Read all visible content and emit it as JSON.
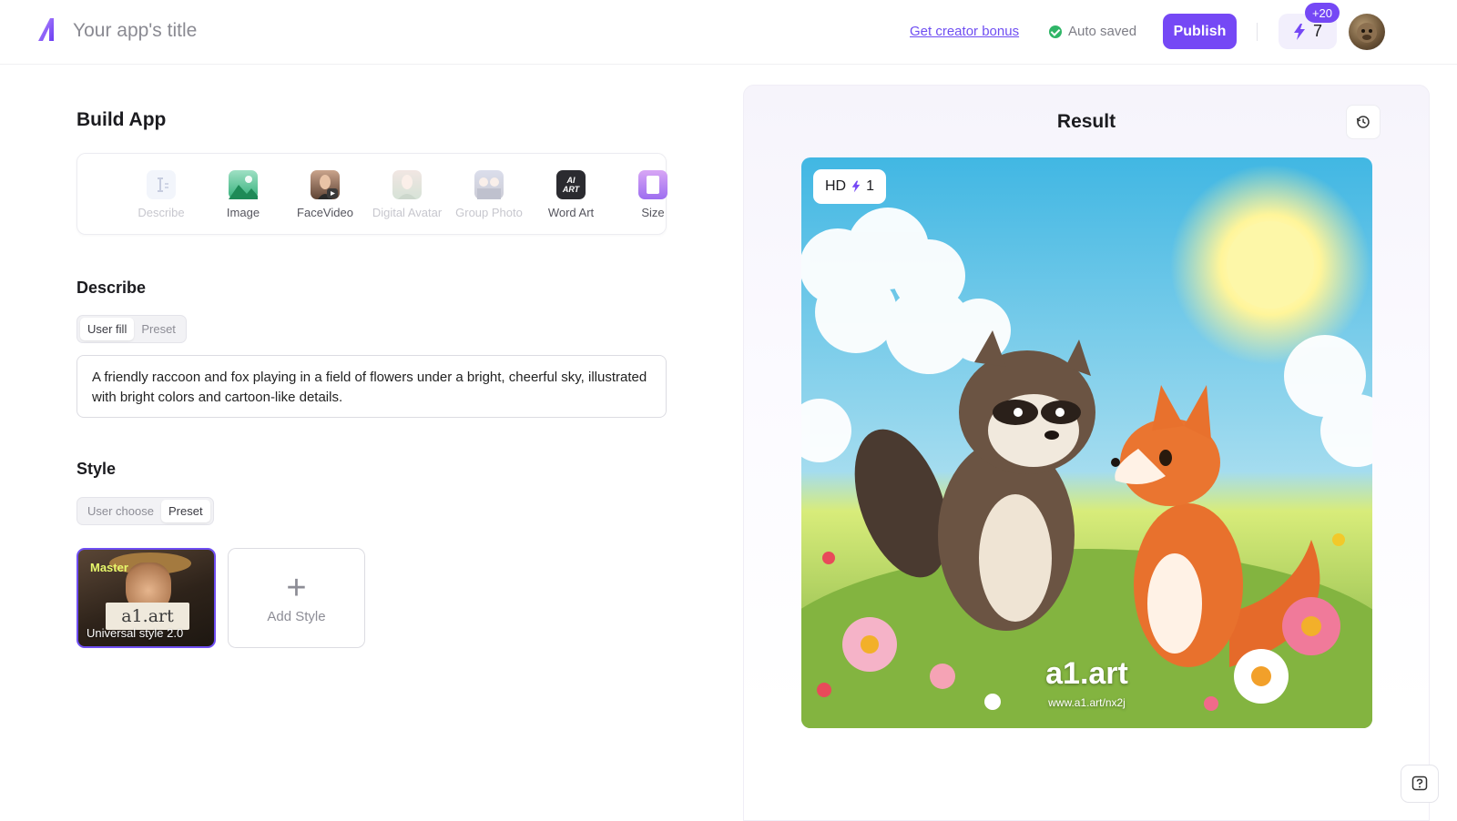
{
  "header": {
    "app_title": "Your app's title",
    "creator_bonus": "Get creator bonus",
    "auto_saved": "Auto saved",
    "publish": "Publish",
    "credits": "7",
    "bonus_badge": "+20"
  },
  "build": {
    "title": "Build App",
    "tools": [
      {
        "label": "Describe",
        "icon": "describe-icon",
        "enabled": false
      },
      {
        "label": "Image",
        "icon": "image-icon",
        "enabled": true
      },
      {
        "label": "FaceVideo",
        "icon": "face-video-icon",
        "enabled": true
      },
      {
        "label": "Digital Avatar",
        "icon": "digital-avatar-icon",
        "enabled": false
      },
      {
        "label": "Group Photo",
        "icon": "group-photo-icon",
        "enabled": false
      },
      {
        "label": "Word Art",
        "icon": "word-art-icon",
        "enabled": true
      },
      {
        "label": "Size",
        "icon": "size-icon",
        "enabled": true
      }
    ],
    "word_art_icon_text": "AI ART"
  },
  "describe": {
    "title": "Describe",
    "options": [
      "User fill",
      "Preset"
    ],
    "selected": "User fill",
    "prompt": "A friendly raccoon and fox playing in a field of flowers under a bright, cheerful sky, illustrated with bright colors and cartoon-like details."
  },
  "style": {
    "title": "Style",
    "options": [
      "User choose",
      "Preset"
    ],
    "selected": "Preset",
    "card": {
      "badge": "Master",
      "sign_text": "a1.art",
      "name": "Universal style 2.0"
    },
    "add_label": "Add Style"
  },
  "result": {
    "title": "Result",
    "hd_label": "HD",
    "hd_cost": "1",
    "watermark": "a1.art",
    "watermark_url": "www.a1.art/nx2j"
  },
  "colors": {
    "accent": "#7548f5",
    "success": "#2fb567"
  }
}
